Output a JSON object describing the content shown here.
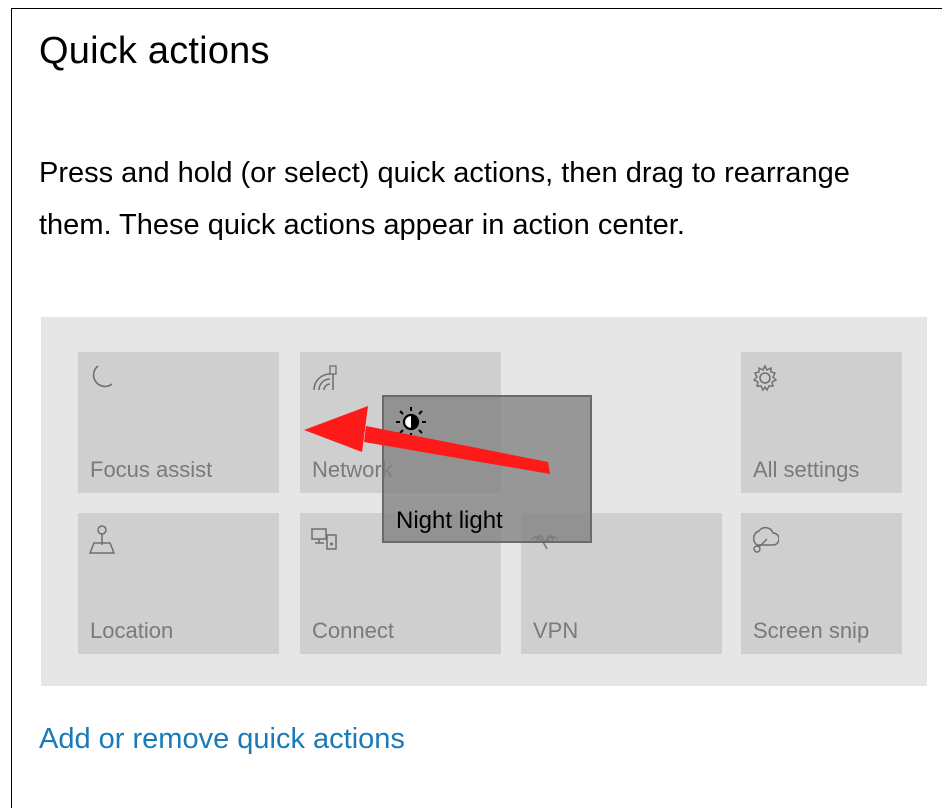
{
  "section": {
    "title": "Quick actions",
    "description": "Press and hold (or select) quick actions, then drag to rearrange them. These quick actions appear in action center."
  },
  "tiles": [
    {
      "label": "Focus assist",
      "icon": "moon-icon"
    },
    {
      "label": "Network",
      "icon": "network-icon"
    },
    {
      "label": "All settings",
      "icon": "gear-icon"
    },
    {
      "label": "Location",
      "icon": "location-icon"
    },
    {
      "label": "Connect",
      "icon": "connect-icon"
    },
    {
      "label": "VPN",
      "icon": "vpn-icon"
    },
    {
      "label": "Screen snip",
      "icon": "screen-snip-icon"
    }
  ],
  "dragging_tile": {
    "label": "Night light",
    "icon": "sun-icon"
  },
  "link": {
    "label": "Add or remove quick actions"
  },
  "colors": {
    "panel": "#e6e6e6",
    "tile": "#cfcfcf",
    "tile_text": "#7a7a7a",
    "link": "#1a7ab8",
    "arrow": "#ff1a1a"
  }
}
